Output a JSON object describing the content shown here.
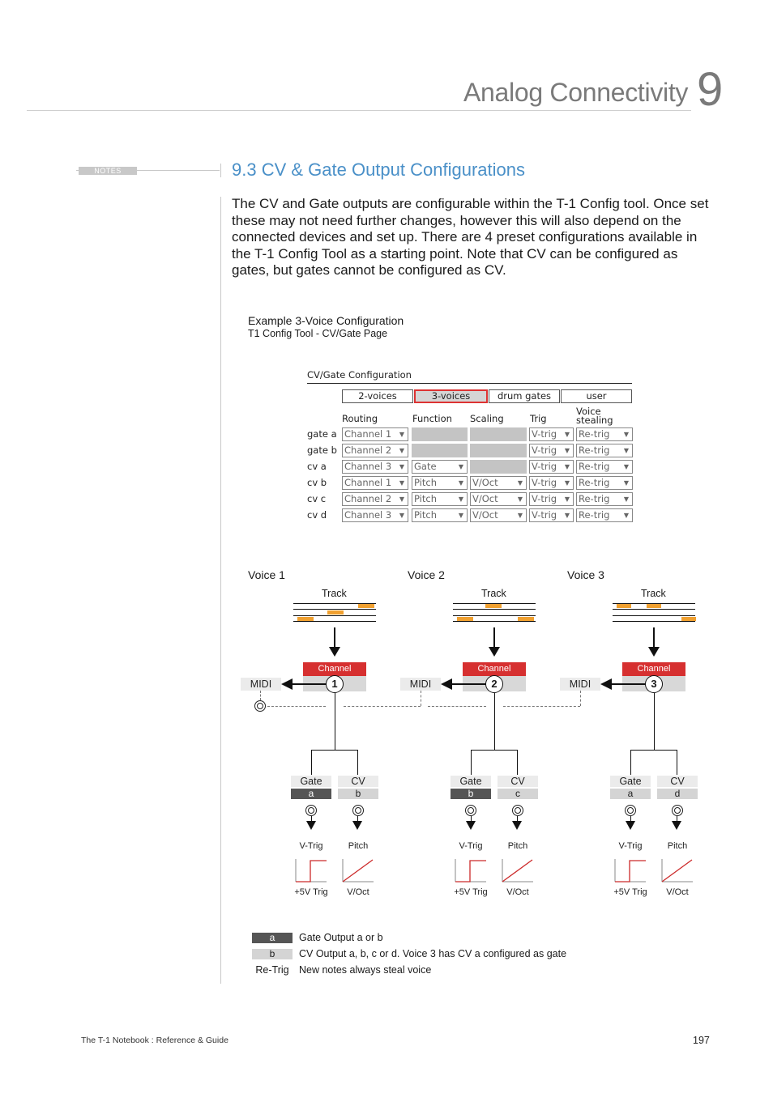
{
  "header": {
    "chapter_title": "Analog Connectivity",
    "chapter_number": "9"
  },
  "margin": {
    "notes_label": "NOTES"
  },
  "section": {
    "title": "9.3 CV & Gate Output Configurations",
    "body": "The CV and Gate outputs are configurable within the T-1 Config tool. Once set these may not need further changes, however this will also depend on the connected devices and set up. There are 4 preset configurations available in the T-1 Config Tool as a starting point. Note that CV can be configured as gates, but gates cannot be configured as CV."
  },
  "example": {
    "title": "Example 3-Voice Configuration",
    "subtitle": "T1 Config Tool - CV/Gate Page"
  },
  "config": {
    "title": "CV/Gate Configuration",
    "presets": [
      "2-voices",
      "3-voices",
      "drum gates",
      "user"
    ],
    "active_preset": "3-voices",
    "columns": [
      "Routing",
      "Function",
      "Scaling",
      "Trig",
      "Voice stealing"
    ],
    "column_vs_line1": "Voice",
    "column_vs_line2": "stealing",
    "rows": [
      {
        "label": "gate a",
        "routing": "Channel 1",
        "function": "",
        "scaling": "",
        "trig": "V-trig",
        "stealing": "Re-trig"
      },
      {
        "label": "gate b",
        "routing": "Channel 2",
        "function": "",
        "scaling": "",
        "trig": "V-trig",
        "stealing": "Re-trig"
      },
      {
        "label": "cv a",
        "routing": "Channel 3",
        "function": "Gate",
        "scaling": "",
        "trig": "V-trig",
        "stealing": "Re-trig"
      },
      {
        "label": "cv b",
        "routing": "Channel 1",
        "function": "Pitch",
        "scaling": "V/Oct",
        "trig": "V-trig",
        "stealing": "Re-trig"
      },
      {
        "label": "cv c",
        "routing": "Channel 2",
        "function": "Pitch",
        "scaling": "V/Oct",
        "trig": "V-trig",
        "stealing": "Re-trig"
      },
      {
        "label": "cv d",
        "routing": "Channel 3",
        "function": "Pitch",
        "scaling": "V/Oct",
        "trig": "V-trig",
        "stealing": "Re-trig"
      }
    ],
    "dropdown_glyph": "▼"
  },
  "diagram": {
    "track_label": "Track",
    "channel_label": "Channel",
    "midi_label": "MIDI",
    "voices": [
      {
        "label": "Voice 1",
        "number": "1",
        "gate_label": "Gate",
        "gate_id": "a",
        "cv_label": "CV",
        "cv_id": "b",
        "gate_trig": "V-Trig",
        "gate_desc": "+5V Trig",
        "cv_func": "Pitch",
        "cv_desc": "V/Oct"
      },
      {
        "label": "Voice 2",
        "number": "2",
        "gate_label": "Gate",
        "gate_id": "b",
        "cv_label": "CV",
        "cv_id": "c",
        "gate_trig": "V-Trig",
        "gate_desc": "+5V Trig",
        "cv_func": "Pitch",
        "cv_desc": "V/Oct"
      },
      {
        "label": "Voice 3",
        "number": "3",
        "gate_label": "Gate",
        "gate_id": "a",
        "cv_label": "CV",
        "cv_id": "d",
        "gate_trig": "V-Trig",
        "gate_desc": "+5V Trig",
        "cv_func": "Pitch",
        "cv_desc": "V/Oct"
      }
    ]
  },
  "legend": [
    {
      "swatch": "a",
      "text": "Gate Output a or b"
    },
    {
      "swatch": "b",
      "text": "CV Output a, b, c or d. Voice 3 has CV a configured as gate"
    },
    {
      "swatch": "Re-Trig",
      "text": "New notes always steal voice"
    }
  ],
  "footer": {
    "book_title": "The T-1 Notebook : Reference & Guide",
    "page_number": "197"
  },
  "colors": {
    "section_title": "#4a90c8",
    "channel_red": "#d63030",
    "note_orange": "#f0a030",
    "active_preset_border": "#dd3333",
    "graph_red": "#cc2a2a"
  }
}
